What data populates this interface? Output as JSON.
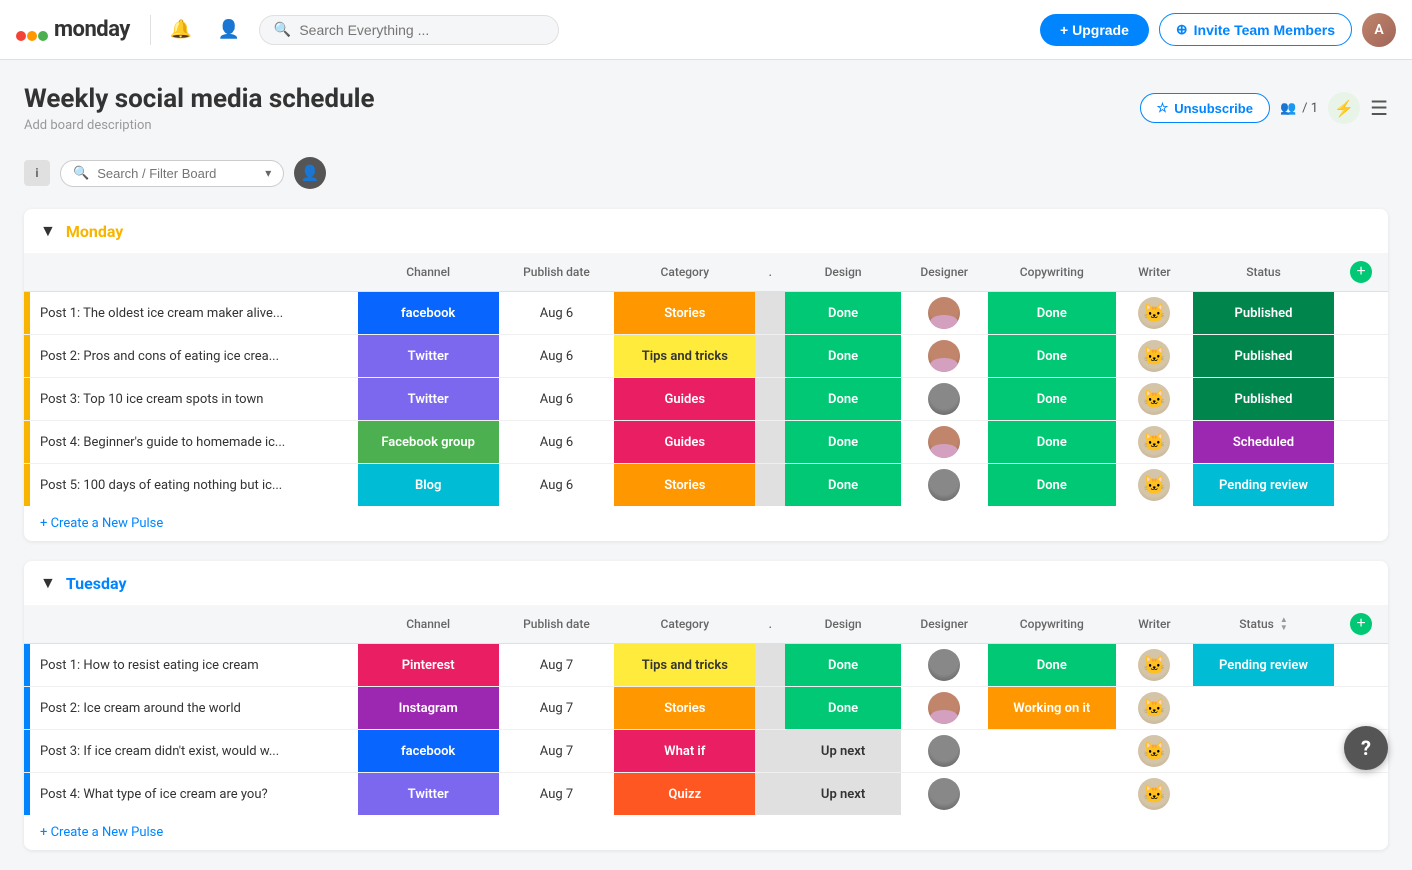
{
  "header": {
    "logo_text": "monday",
    "search_placeholder": "Search Everything ...",
    "upgrade_label": "+ Upgrade",
    "invite_label": "Invite Team Members",
    "members_count": "/ 1"
  },
  "board": {
    "title": "Weekly social media schedule",
    "description": "Add board description",
    "unsubscribe_label": "Unsubscribe",
    "search_filter_placeholder": "Search / Filter Board"
  },
  "monday_group": {
    "title": "Monday",
    "columns": [
      "Channel",
      "Publish date",
      "Category",
      ".",
      "Design",
      "Designer",
      "Copywriting",
      "Writer",
      "Status"
    ],
    "rows": [
      {
        "title": "Post 1: The oldest ice cream maker alive...",
        "channel": "facebook",
        "channel_label": "facebook",
        "date": "Aug 6",
        "category": "Stories",
        "cat_class": "cat-stories",
        "design": "Done",
        "designer": "female",
        "copywriting": "Done",
        "writer": "cat",
        "status": "Published",
        "status_class": "status-published"
      },
      {
        "title": "Post 2: Pros and cons of eating ice crea...",
        "channel": "twitter",
        "channel_label": "Twitter",
        "date": "Aug 6",
        "category": "Tips and tricks",
        "cat_class": "cat-tips",
        "design": "Done",
        "designer": "female",
        "copywriting": "Done",
        "writer": "cat2",
        "status": "Published",
        "status_class": "status-published"
      },
      {
        "title": "Post 3: Top 10 ice cream spots in town",
        "channel": "twitter",
        "channel_label": "Twitter",
        "date": "Aug 6",
        "category": "Guides",
        "cat_class": "cat-guides",
        "design": "Done",
        "designer": "male",
        "copywriting": "Done",
        "writer": "cat2",
        "status": "Published",
        "status_class": "status-published"
      },
      {
        "title": "Post 4: Beginner's guide to homemade ic...",
        "channel": "facebook-group",
        "channel_label": "Facebook group",
        "date": "Aug 6",
        "category": "Guides",
        "cat_class": "cat-guides",
        "design": "Done",
        "designer": "female",
        "copywriting": "Done",
        "writer": "cat2",
        "status": "Scheduled",
        "status_class": "status-scheduled"
      },
      {
        "title": "Post 5: 100 days of eating nothing but ic...",
        "channel": "blog",
        "channel_label": "Blog",
        "date": "Aug 6",
        "category": "Stories",
        "cat_class": "cat-stories",
        "design": "Done",
        "designer": "male",
        "copywriting": "Done",
        "writer": "cat",
        "status": "Pending review",
        "status_class": "status-pending"
      }
    ],
    "create_pulse": "+ Create a New Pulse"
  },
  "tuesday_group": {
    "title": "Tuesday",
    "columns": [
      "Channel",
      "Publish date",
      "Category",
      ".",
      "Design",
      "Designer",
      "Copywriting",
      "Writer",
      "Status"
    ],
    "rows": [
      {
        "title": "Post 1: How to resist eating ice cream",
        "channel": "pinterest",
        "channel_label": "Pinterest",
        "date": "Aug 7",
        "category": "Tips and tricks",
        "cat_class": "cat-tips",
        "design": "Done",
        "designer": "male",
        "copywriting": "Done",
        "writer": "cat",
        "status": "Pending review",
        "status_class": "status-pending"
      },
      {
        "title": "Post 2: Ice cream around the world",
        "channel": "instagram",
        "channel_label": "Instagram",
        "date": "Aug 7",
        "category": "Stories",
        "cat_class": "cat-stories",
        "design": "Done",
        "designer": "female",
        "copywriting": "Working on it",
        "writer": "cat2",
        "status": "",
        "status_class": ""
      },
      {
        "title": "Post 3: If ice cream didn't exist, would w...",
        "channel": "facebook",
        "channel_label": "facebook",
        "date": "Aug 7",
        "category": "What if",
        "cat_class": "cat-whatif",
        "design": "Up next",
        "design_class": "status-upnext",
        "designer": "male",
        "copywriting": "",
        "writer": "cat",
        "status": "",
        "status_class": ""
      },
      {
        "title": "Post 4: What type of ice cream are you?",
        "channel": "twitter",
        "channel_label": "Twitter",
        "date": "Aug 7",
        "category": "Quizz",
        "cat_class": "cat-quizz",
        "design": "Up next",
        "design_class": "status-upnext",
        "designer": "male",
        "copywriting": "",
        "writer": "cat",
        "status": "",
        "status_class": ""
      }
    ],
    "create_pulse": "+ Create a New Pulse"
  }
}
